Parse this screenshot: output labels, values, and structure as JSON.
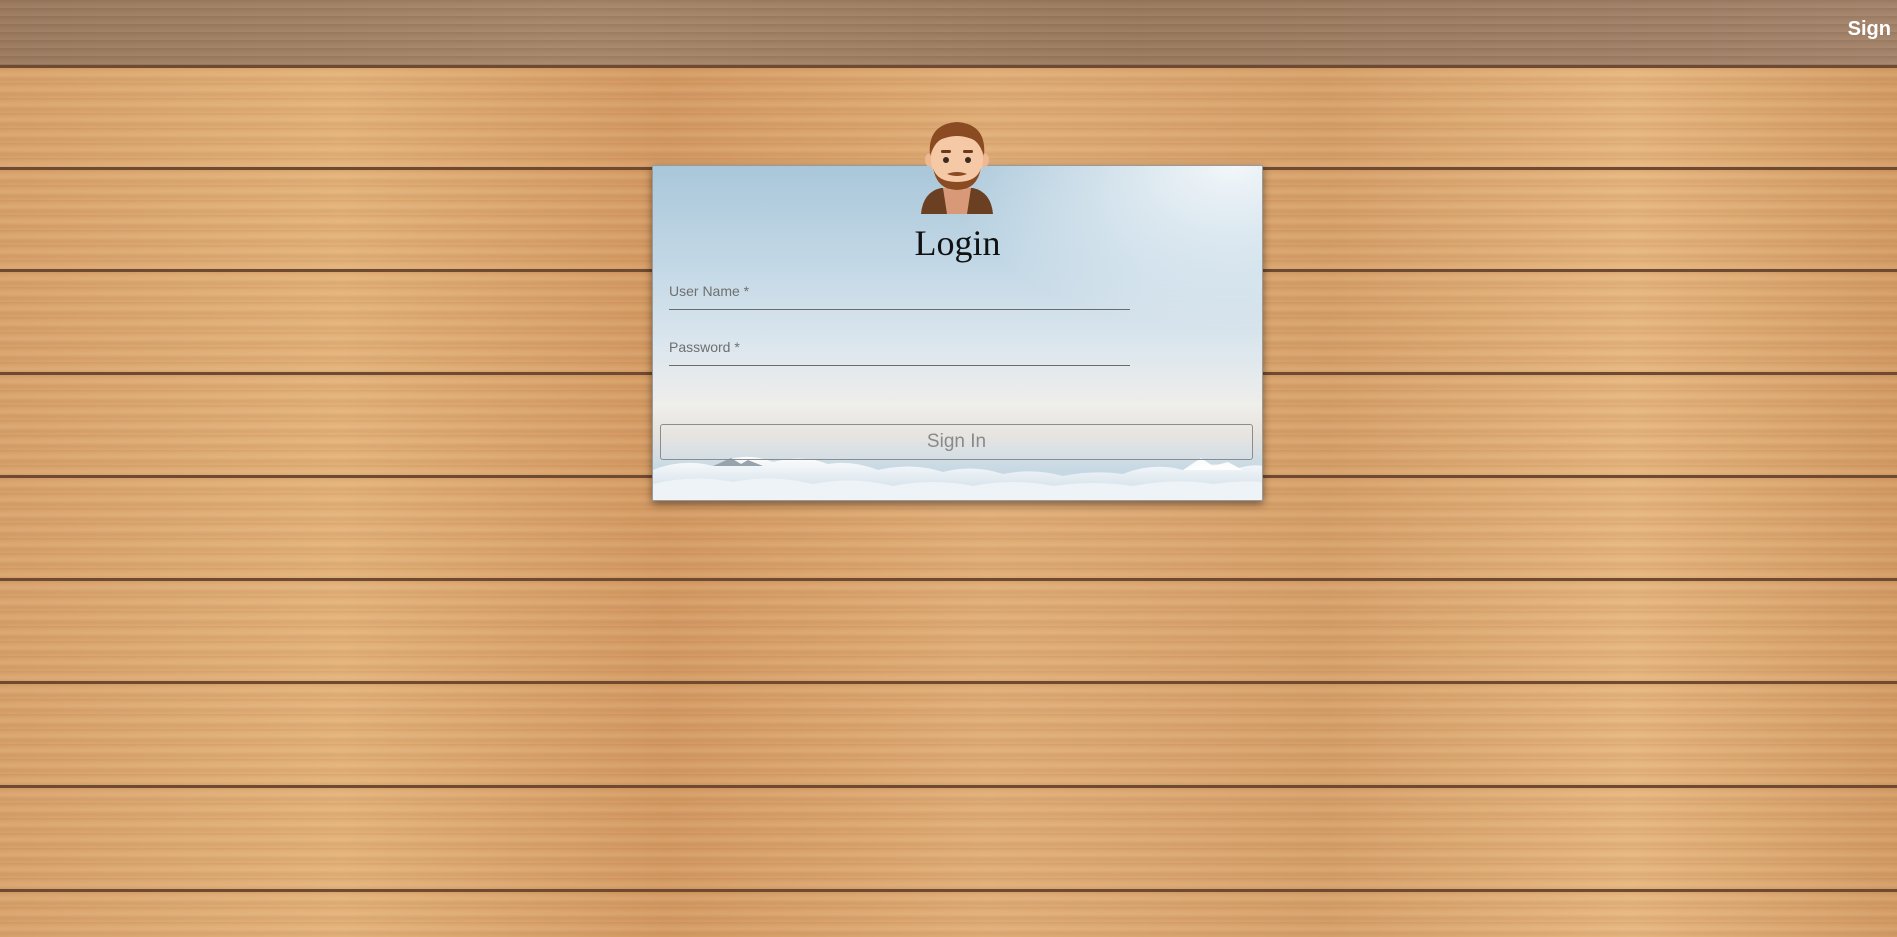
{
  "topbar": {
    "sign_link": "Sign"
  },
  "login": {
    "title": "Login",
    "username_label": "User Name *",
    "password_label": "Password *",
    "signin_label": "Sign In",
    "avatar_icon": "male-user-avatar-icon"
  }
}
